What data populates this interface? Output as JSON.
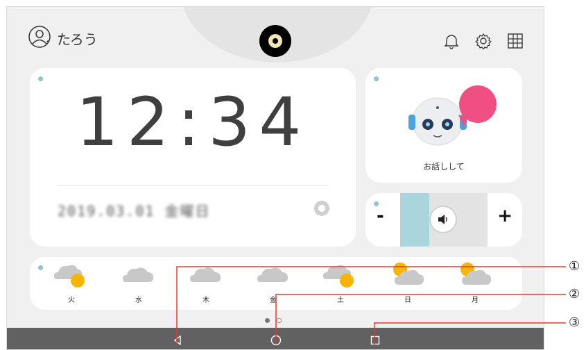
{
  "header": {
    "username": "たろう",
    "icons": [
      "user-icon",
      "bell-icon",
      "gear-icon",
      "grid-icon"
    ]
  },
  "clock": {
    "time": "12:34",
    "date_blurred": "2019.03.01 金曜日"
  },
  "robot": {
    "label": "お話しして"
  },
  "volume": {
    "minus": "-",
    "plus": "+",
    "level": 0.25
  },
  "weather": {
    "days": [
      {
        "label": "火",
        "icon": "cloud-sun-icon"
      },
      {
        "label": "水",
        "icon": "cloud-icon"
      },
      {
        "label": "木",
        "icon": "cloud-icon"
      },
      {
        "label": "金",
        "icon": "cloud-icon"
      },
      {
        "label": "土",
        "icon": "cloud-sun-icon"
      },
      {
        "label": "日",
        "icon": "sun-cloud-icon"
      },
      {
        "label": "月",
        "icon": "sun-cloud-icon"
      }
    ]
  },
  "pager": {
    "current": 1,
    "total": 2
  },
  "nav": {
    "buttons": [
      "back-icon",
      "home-icon",
      "recent-apps-icon"
    ]
  },
  "callouts": [
    "①",
    "②",
    "③"
  ],
  "colors": {
    "accent_teal": "#a9d6dd",
    "indicator_dot": "#8cc3c9",
    "speech_pink": "#ef4f83",
    "sun_yellow": "#f7b500",
    "cloud_gray": "#c8c8c8",
    "navbar": "#616161",
    "callout_line": "#e53935"
  }
}
